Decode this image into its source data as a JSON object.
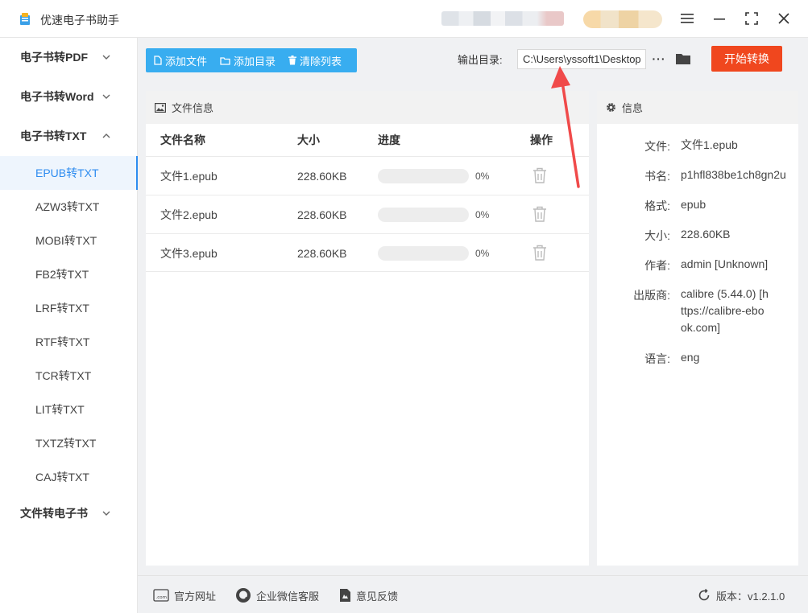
{
  "app": {
    "title": "优速电子书助手"
  },
  "sidebar": {
    "groups": [
      {
        "label": "电子书转PDF",
        "expanded": false
      },
      {
        "label": "电子书转Word",
        "expanded": false
      },
      {
        "label": "电子书转TXT",
        "expanded": true
      },
      {
        "label": "文件转电子书",
        "expanded": false
      }
    ],
    "items": [
      {
        "label": "EPUB转TXT",
        "active": true
      },
      {
        "label": "AZW3转TXT"
      },
      {
        "label": "MOBI转TXT"
      },
      {
        "label": "FB2转TXT"
      },
      {
        "label": "LRF转TXT"
      },
      {
        "label": "RTF转TXT"
      },
      {
        "label": "TCR转TXT"
      },
      {
        "label": "LIT转TXT"
      },
      {
        "label": "TXTZ转TXT"
      },
      {
        "label": "CAJ转TXT"
      }
    ]
  },
  "toolbar": {
    "add_file": "添加文件",
    "add_dir": "添加目录",
    "clear_list": "清除列表",
    "output_label": "输出目录:",
    "output_path": "C:\\Users\\yssoft1\\Desktop",
    "more": "···",
    "start": "开始转换"
  },
  "files": {
    "panel_title": "文件信息",
    "columns": {
      "name": "文件名称",
      "size": "大小",
      "progress": "进度",
      "action": "操作"
    },
    "rows": [
      {
        "name": "文件1.epub",
        "size": "228.60KB",
        "progress": 0,
        "progress_text": "0%"
      },
      {
        "name": "文件2.epub",
        "size": "228.60KB",
        "progress": 0,
        "progress_text": "0%"
      },
      {
        "name": "文件3.epub",
        "size": "228.60KB",
        "progress": 0,
        "progress_text": "0%"
      }
    ]
  },
  "info": {
    "panel_title": "信息",
    "fields": [
      {
        "label": "文件:",
        "value": "文件1.epub"
      },
      {
        "label": "书名:",
        "value": "p1hfl838be1ch8gn2u"
      },
      {
        "label": "格式:",
        "value": "epub"
      },
      {
        "label": "大小:",
        "value": "228.60KB"
      },
      {
        "label": "作者:",
        "value": "admin [Unknown]"
      },
      {
        "label": "出版商:",
        "value": "calibre (5.44.0) [https://calibre-ebook.com]"
      },
      {
        "label": "语言:",
        "value": "eng"
      }
    ]
  },
  "footer": {
    "website": "官方网址",
    "wechat": "企业微信客服",
    "feedback": "意见反馈",
    "version": "版本：v1.2.1.0"
  },
  "colors": {
    "accent": "#38adf0",
    "start": "#f0471e",
    "active_text": "#2d8cf0",
    "annotation": "#f04a4a"
  }
}
